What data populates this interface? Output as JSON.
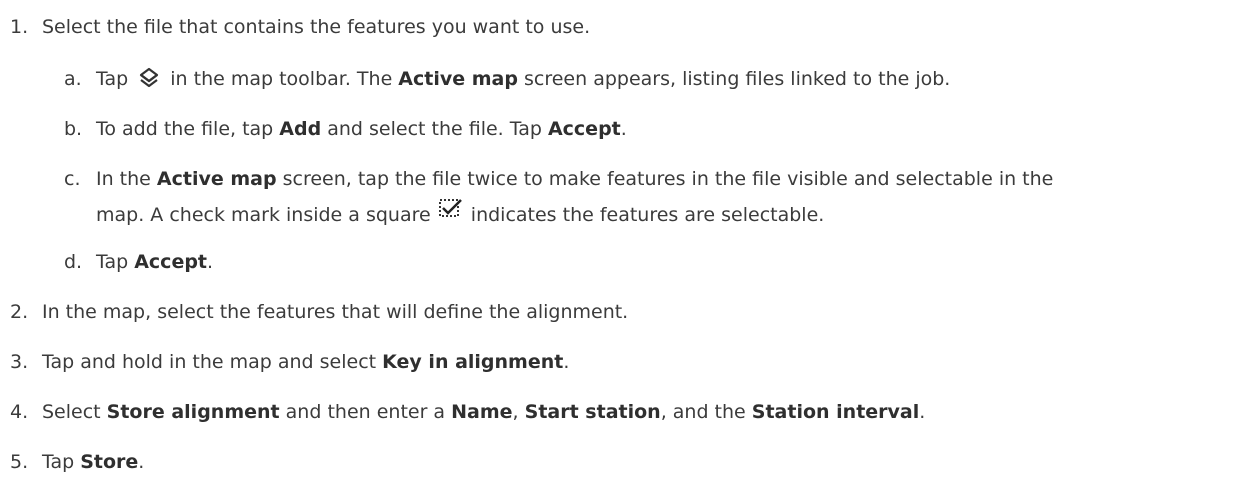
{
  "steps": [
    {
      "num": "1.",
      "text": "Select the file that contains the features you want to use."
    },
    {
      "num": "2.",
      "text": "In the map, select the features that will define the alignment."
    },
    {
      "num": "3.",
      "pre": "Tap and hold in the map and select ",
      "b1": "Key in alignment",
      "post": "."
    },
    {
      "num": "4.",
      "pre": "Select ",
      "b1": "Store alignment",
      "mid1": " and then enter a ",
      "b2": "Name",
      "mid2": ", ",
      "b3": "Start station",
      "mid3": ", and the ",
      "b4": "Station interval",
      "post": "."
    },
    {
      "num": "5.",
      "pre": "Tap ",
      "b1": "Store",
      "post": "."
    }
  ],
  "substeps": [
    {
      "num": "a.",
      "pre": "Tap ",
      "icon": "layers-icon",
      "mid": " in the map toolbar. The ",
      "b1": "Active map",
      "post": " screen appears, listing files linked to the job."
    },
    {
      "num": "b.",
      "pre": "To add the file, tap ",
      "b1": "Add",
      "mid": " and select the file. Tap ",
      "b2": "Accept",
      "post": "."
    },
    {
      "num": "c.",
      "pre": "In the ",
      "b1": "Active map",
      "post": " screen, tap the file twice to make features in the file visible and selectable in the",
      "line2_pre": "map. A check mark inside a square ",
      "icon": "checkbox-icon",
      "line2_post": " indicates the features are selectable."
    },
    {
      "num": "d.",
      "pre": "Tap ",
      "b1": "Accept",
      "post": "."
    }
  ]
}
